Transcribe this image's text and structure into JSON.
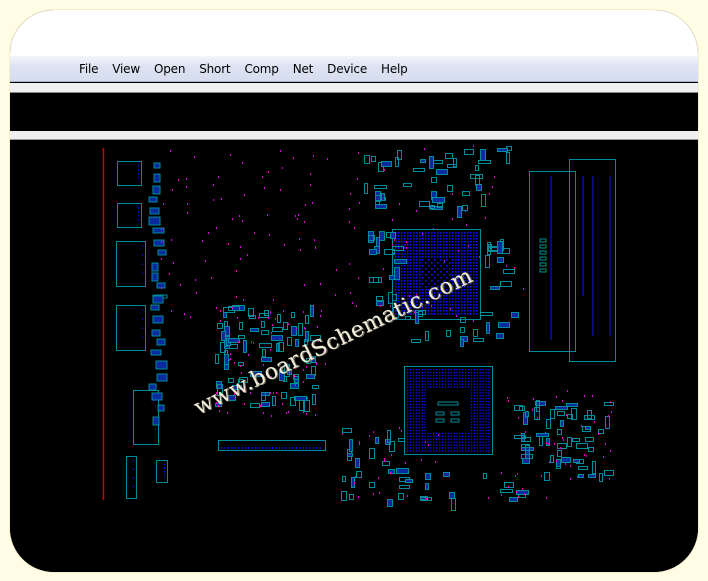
{
  "app": {
    "menu": [
      {
        "label": "File"
      },
      {
        "label": "View"
      },
      {
        "label": "Open"
      },
      {
        "label": "Short"
      },
      {
        "label": "Comp"
      },
      {
        "label": "Net"
      },
      {
        "label": "Device"
      },
      {
        "label": "Help"
      }
    ]
  },
  "canvas": {
    "watermark": "www.boardSchematic.com",
    "colors": {
      "background": "#000000",
      "outline": "#008b9a",
      "pin": "#1010ff",
      "via": "#e000e0",
      "edge": "#d00000"
    }
  },
  "page": {
    "background": "#fffde3"
  }
}
